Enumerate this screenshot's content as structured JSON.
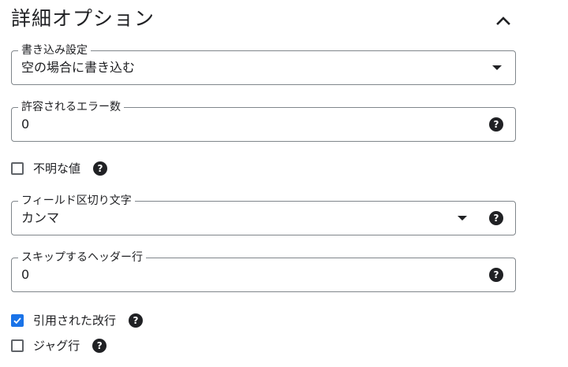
{
  "section": {
    "title": "詳細オプション",
    "collapse_icon": "chevron-up-icon"
  },
  "write_preference": {
    "label": "書き込み設定",
    "value": "空の場合に書き込む"
  },
  "max_bad_records": {
    "label": "許容されるエラー数",
    "value": "0"
  },
  "ignore_unknown_values": {
    "label": "不明な値",
    "checked": false
  },
  "field_delimiter": {
    "label": "フィールド区切り文字",
    "value": "カンマ"
  },
  "skip_header_rows": {
    "label": "スキップするヘッダー行",
    "value": "0"
  },
  "allow_quoted_newlines": {
    "label": "引用された改行",
    "checked": true
  },
  "allow_jagged_rows": {
    "label": "ジャグ行",
    "checked": false
  },
  "help_icon_glyph": "?",
  "colors": {
    "text": "#202124",
    "border": "#80868b",
    "checkbox_checked": "#1a73e8"
  }
}
